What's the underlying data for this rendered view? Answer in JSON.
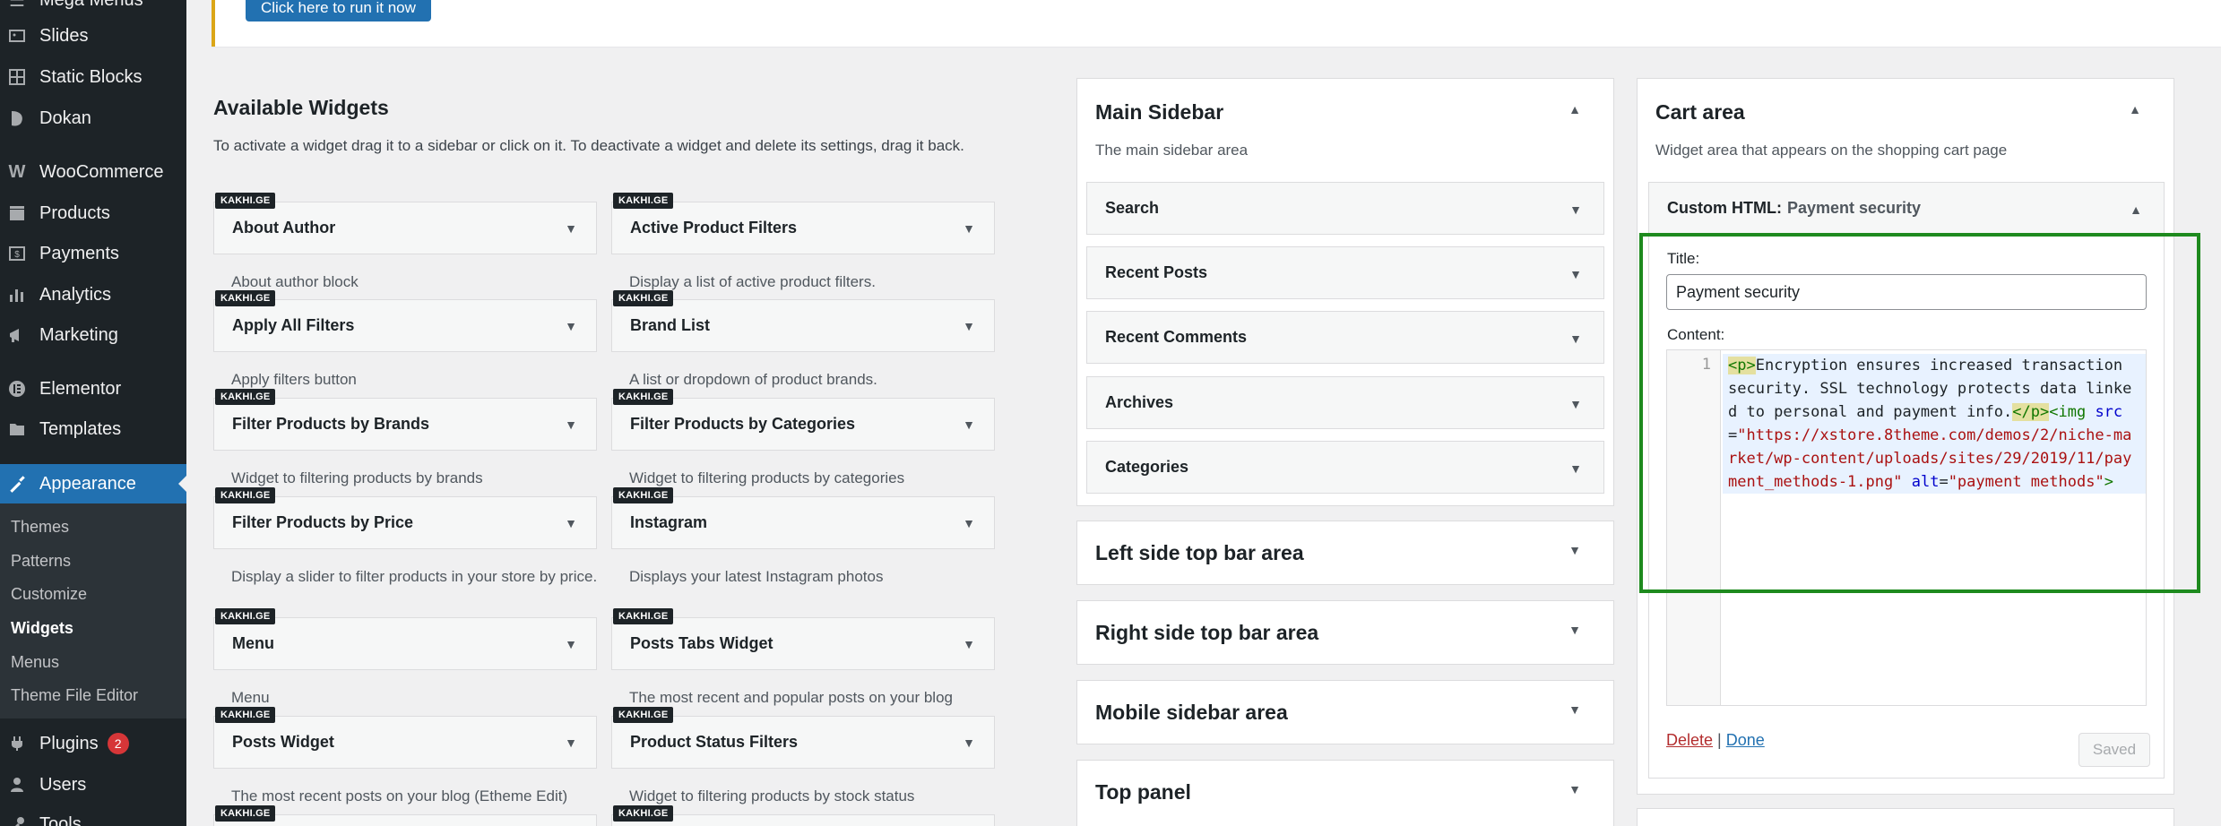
{
  "admin_menu": {
    "items": [
      {
        "label": "Mega Menus",
        "icon": "menu-icon"
      },
      {
        "label": "Slides",
        "icon": "slides-icon"
      },
      {
        "label": "Static Blocks",
        "icon": "blocks-icon"
      },
      {
        "label": "Dokan",
        "icon": "dokan-icon"
      },
      {
        "label": "WooCommerce",
        "icon": "woocommerce-icon"
      },
      {
        "label": "Products",
        "icon": "products-icon"
      },
      {
        "label": "Payments",
        "icon": "payments-icon"
      },
      {
        "label": "Analytics",
        "icon": "analytics-icon"
      },
      {
        "label": "Marketing",
        "icon": "marketing-icon"
      },
      {
        "label": "Elementor",
        "icon": "elementor-icon"
      },
      {
        "label": "Templates",
        "icon": "templates-icon"
      },
      {
        "label": "Appearance",
        "icon": "appearance-icon"
      },
      {
        "label": "Plugins",
        "icon": "plugins-icon",
        "badge": "2"
      },
      {
        "label": "Users",
        "icon": "users-icon"
      },
      {
        "label": "Tools",
        "icon": "tools-icon"
      }
    ],
    "appearance_submenu": [
      "Themes",
      "Patterns",
      "Customize",
      "Widgets",
      "Menus",
      "Theme File Editor"
    ],
    "current_submenu": "Widgets"
  },
  "notice": {
    "button_label": "Click here to run it now"
  },
  "available_widgets": {
    "title": "Available Widgets",
    "description": "To activate a widget drag it to a sidebar or click on it. To deactivate a widget and delete its settings, drag it back.",
    "tag": "KAKHI.GE",
    "widgets": [
      {
        "name": "About Author",
        "desc": "About author block"
      },
      {
        "name": "Active Product Filters",
        "desc": "Display a list of active product filters."
      },
      {
        "name": "Apply All Filters",
        "desc": "Apply filters button"
      },
      {
        "name": "Brand List",
        "desc": "A list or dropdown of product brands."
      },
      {
        "name": "Filter Products by Brands",
        "desc": "Widget to filtering products by brands"
      },
      {
        "name": "Filter Products by Categories",
        "desc": "Widget to filtering products by categories"
      },
      {
        "name": "Filter Products by Price",
        "desc": "Display a slider to filter products in your store by price."
      },
      {
        "name": "Instagram",
        "desc": "Displays your latest Instagram photos"
      },
      {
        "name": "Menu",
        "desc": "Menu"
      },
      {
        "name": "Posts Tabs Widget",
        "desc": "The most recent and popular posts on your blog"
      },
      {
        "name": "Posts Widget",
        "desc": "The most recent posts on your blog (Etheme Edit)"
      },
      {
        "name": "Product Status Filters",
        "desc": "Widget to filtering products by stock status"
      }
    ]
  },
  "main_sidebar": {
    "title": "Main Sidebar",
    "description": "The main sidebar area",
    "widgets": [
      "Search",
      "Recent Posts",
      "Recent Comments",
      "Archives",
      "Categories"
    ]
  },
  "other_sidebars": [
    "Left side top bar area",
    "Right side top bar area",
    "Mobile sidebar area",
    "Top panel"
  ],
  "cart_area": {
    "title": "Cart area",
    "description": "Widget area that appears on the shopping cart page",
    "widget_type": "Custom HTML:",
    "widget_title": "Payment security",
    "title_label": "Title:",
    "title_value": "Payment security",
    "content_label": "Content:",
    "line_number": "1",
    "code": {
      "open_p": "<p>",
      "text": "Encryption ensures increased transaction security. SSL technology protects data linked to personal and payment info.",
      "close_p": "</p>",
      "img_open": "<img",
      "src_attr": "src",
      "eq": "=",
      "src_val": "\"https://xstore.8theme.com/demos/2/niche-market/wp-content/uploads/sites/29/2019/11/payment_methods-1.png\"",
      "alt_attr": "alt",
      "alt_val": "\"payment methods\"",
      "img_close": ">"
    },
    "delete_label": "Delete",
    "separator": "|",
    "done_label": "Done",
    "saved_label": "Saved"
  },
  "colors": {
    "accent": "#2271b1",
    "highlight": "#1e8a1e",
    "sidebar_bg": "#1d2327"
  }
}
